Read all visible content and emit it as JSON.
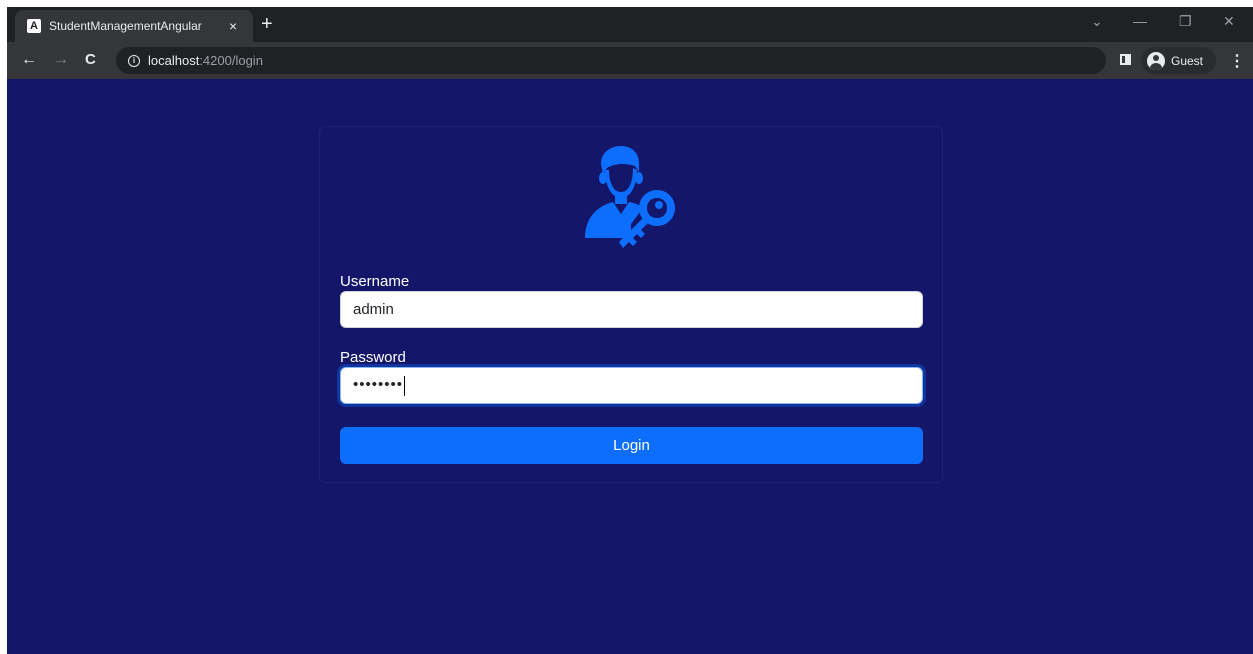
{
  "browser": {
    "tab_title": "StudentManagementAngular",
    "tab_favicon": "A",
    "tab_close": "×",
    "new_tab": "+",
    "url_host": "localhost",
    "url_path": ":4200/login",
    "profile_name": "Guest",
    "back_glyph": "←",
    "forward_glyph": "→",
    "reload_glyph": "C",
    "menu_glyph": "⋮",
    "info_glyph": "i",
    "dropdown_glyph": "⌄",
    "minimize_glyph": "—",
    "restore_glyph": "❐",
    "close_glyph": "✕"
  },
  "login": {
    "username_label": "Username",
    "username_value": "admin",
    "password_label": "Password",
    "password_value": "••••••••",
    "login_button": "Login"
  },
  "colors": {
    "page_background": "#14166a",
    "accent": "#0d6efd",
    "icon": "#0d6efd"
  },
  "icons": {
    "logo": "user-key-icon"
  }
}
